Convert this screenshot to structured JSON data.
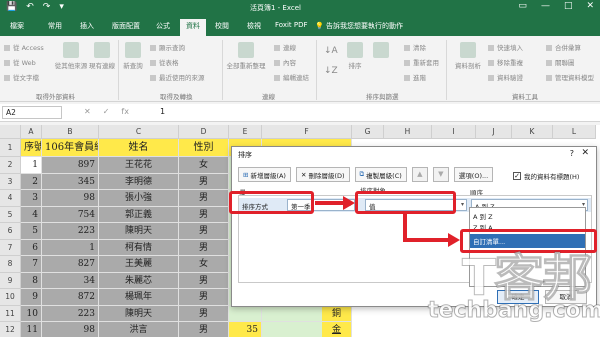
{
  "window": {
    "title": "活頁簿1 - Excel",
    "qat": [
      "💾",
      "↶",
      "↷",
      "▾"
    ],
    "controls": [
      "▭",
      "—",
      "□",
      "✕"
    ]
  },
  "ribbon_tabs": [
    {
      "label": "檔案",
      "active": false
    },
    {
      "label": "常用",
      "active": false
    },
    {
      "label": "插入",
      "active": false
    },
    {
      "label": "版面配置",
      "active": false
    },
    {
      "label": "公式",
      "active": false
    },
    {
      "label": "資料",
      "active": true
    },
    {
      "label": "校閱",
      "active": false
    },
    {
      "label": "檢視",
      "active": false
    },
    {
      "label": "Foxit PDF",
      "active": false
    }
  ],
  "tell_me": "告訴我您想要執行的動作",
  "ribbon": {
    "external": {
      "items": [
        "從 Access",
        "從 Web",
        "從文字檔"
      ],
      "big1": "從其他來源",
      "big2": "現有連線",
      "label": "取得外部資料"
    },
    "transform": {
      "big": "新查詢",
      "items": [
        "顯示查詢",
        "從表格",
        "最近使用的來源"
      ],
      "label": "取得及轉換"
    },
    "connections": {
      "big": "全部重新整理",
      "items": [
        "連線",
        "內容",
        "編輯連結"
      ],
      "label": "連線"
    },
    "sort": {
      "big": "排序",
      "items": [
        "清除",
        "重新套用",
        "進階"
      ],
      "label": "排序與篩選"
    },
    "datatools": {
      "big1": "資料剖析",
      "items": [
        "快速填入",
        "移除重複",
        "資料驗證"
      ],
      "items2": [
        "合併彙算",
        "關聯圖",
        "管理資料模型"
      ],
      "label": "資料工具"
    }
  },
  "formula_bar": {
    "name_box": "A2",
    "icons": [
      "✕",
      "✓",
      "fx"
    ],
    "value": "1"
  },
  "grid": {
    "columns": [
      "A",
      "B",
      "C",
      "D",
      "E",
      "F",
      "G",
      "H",
      "I",
      "J",
      "K",
      "L"
    ],
    "rows": [
      "1",
      "2",
      "3",
      "4",
      "5",
      "6",
      "7",
      "8",
      "9",
      "10",
      "11",
      "12"
    ],
    "header_row": [
      "序號",
      "106年會員編號",
      "姓名",
      "性別",
      "",
      ""
    ],
    "data": [
      [
        "1",
        "897",
        "王花花",
        "女"
      ],
      [
        "2",
        "345",
        "李明德",
        "男"
      ],
      [
        "3",
        "98",
        "張小強",
        "男"
      ],
      [
        "4",
        "754",
        "郭正義",
        "男"
      ],
      [
        "5",
        "223",
        "陳明天",
        "男"
      ],
      [
        "6",
        "1",
        "柯有情",
        "男"
      ],
      [
        "7",
        "827",
        "王美麗",
        "女"
      ],
      [
        "8",
        "34",
        "朱麗芯",
        "男"
      ],
      [
        "9",
        "872",
        "楊珮年",
        "男"
      ],
      [
        "10",
        "223",
        "陳明天",
        "男"
      ],
      [
        "11",
        "98",
        "洪言",
        "男"
      ]
    ],
    "extra": {
      "row11_e": "35",
      "row11_f": "金",
      "row10_f": "銅"
    }
  },
  "dialog": {
    "title": "排序",
    "help": "?",
    "close": "✕",
    "buttons": {
      "add": "新增層級(A)",
      "delete": "刪除層級(D)",
      "copy": "複製層級(C)",
      "up": "▲",
      "down": "▼",
      "options": "選項(O)..."
    },
    "has_header": "我的資料有標題(H)",
    "col_headers": {
      "column": "欄",
      "sort_on": "排序對象",
      "order": "順序"
    },
    "row": {
      "sort_by": "排序方式",
      "column_value": "第一季",
      "sort_on_value": "值",
      "order_value": "A 到 Z"
    },
    "order_options": [
      "A 到 Z",
      "Z 到 A",
      "自訂清單..."
    ],
    "ok": "確定",
    "cancel": "取消"
  },
  "watermark": {
    "logo": "T客邦",
    "url": "techbang.com"
  },
  "colors": {
    "excel_green": "#217346",
    "header_yellow": "#ffe94a",
    "selection_gray": "#aaaaaa",
    "annotation_red": "#e0212a",
    "highlight_blue": "#2f6fb5"
  }
}
